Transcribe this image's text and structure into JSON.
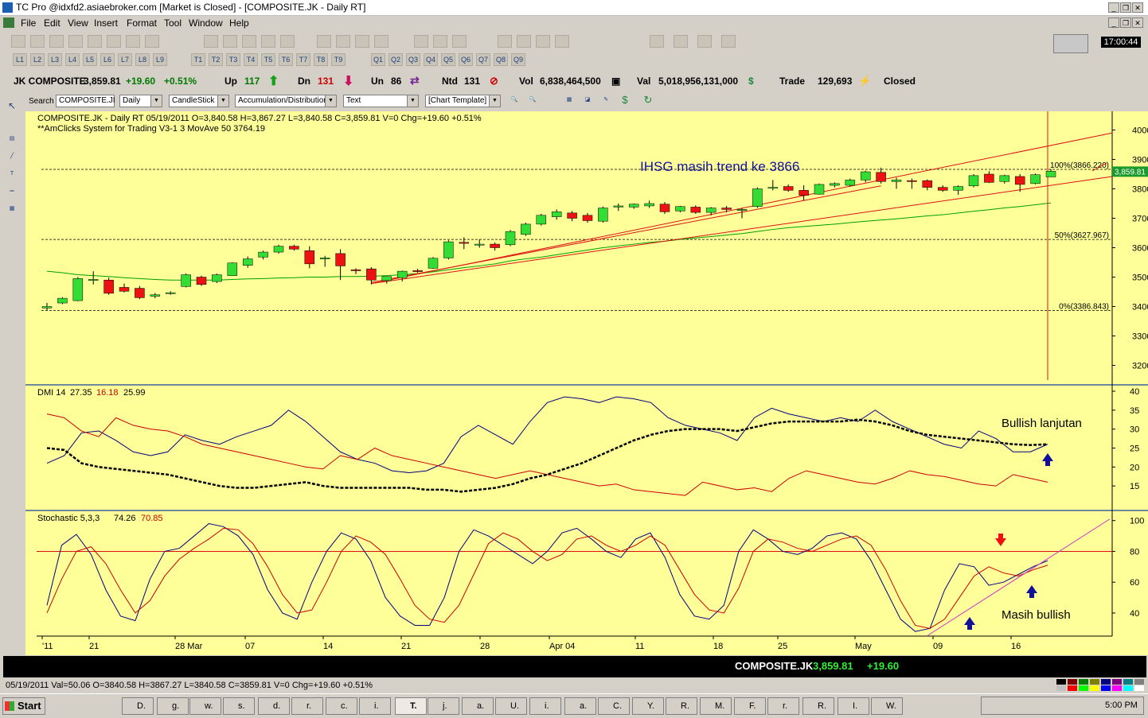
{
  "window": {
    "title": "TC Pro @idxfd2.asiaebroker.com [Market is Closed] - [COMPOSITE.JK - Daily RT]",
    "clock": "17:00:44"
  },
  "menu": [
    "File",
    "Edit",
    "View",
    "Insert",
    "Format",
    "Tool",
    "Window",
    "Help"
  ],
  "toolbar": {
    "layouts": [
      "L1",
      "L2",
      "L3",
      "L4",
      "L5",
      "L6",
      "L7",
      "L8",
      "L9"
    ],
    "templates": [
      "T1",
      "T2",
      "T3",
      "T4",
      "T5",
      "T6",
      "T7",
      "T8",
      "T9"
    ],
    "quotes": [
      "Q1",
      "Q2",
      "Q3",
      "Q4",
      "Q5",
      "Q6",
      "Q7",
      "Q8",
      "Q9"
    ]
  },
  "quote_bar": {
    "name": "JK COMPOSITE",
    "last": "3,859.81",
    "chg": "+19.60",
    "pct": "+0.51%",
    "up_label": "Up",
    "up": "117",
    "dn_label": "Dn",
    "dn": "131",
    "un_label": "Un",
    "un": "86",
    "ntd_label": "Ntd",
    "ntd": "131",
    "vol_label": "Vol",
    "vol": "6,838,464,500",
    "val_label": "Val",
    "val": "5,018,956,131,000",
    "trade_label": "Trade",
    "trade": "129,693",
    "status": "Closed"
  },
  "controls": {
    "search_label": "Search",
    "symbol": "COMPOSITE.JI",
    "period": "Daily",
    "style": "CandleStick",
    "indicator": "Accumulation/Distributior",
    "tool": "Text",
    "template": "[Chart Template]"
  },
  "chart_data": [
    {
      "type": "candlestick",
      "header": "COMPOSITE.JK - Daily RT  05/19/2011  O=3,840.58  H=3,867.27  L=3,840.58  C=3,859.81  V=0  Chg=+19.60  +0.51%",
      "subheader": "**AmClicks System for Trading V3-1 3   MovAve 50  3764.19",
      "annotation": "IHSG masih trend ke 3866",
      "ylim": [
        3150,
        4050
      ],
      "yticks": [
        3200,
        3300,
        3400,
        3500,
        3600,
        3700,
        3800,
        3900,
        4000
      ],
      "last_value_label": "3,859.81",
      "fib_levels": [
        {
          "label": "100%(3866.220)",
          "value": 3866.22
        },
        {
          "label": "50%(3627.967)",
          "value": 3627.967
        },
        {
          "label": "0%(3386.843)",
          "value": 3386.843
        }
      ],
      "candles": [
        {
          "o": 3395,
          "h": 3412,
          "l": 3388,
          "c": 3400
        },
        {
          "o": 3412,
          "h": 3432,
          "l": 3408,
          "c": 3428
        },
        {
          "o": 3420,
          "h": 3500,
          "l": 3418,
          "c": 3495
        },
        {
          "o": 3490,
          "h": 3520,
          "l": 3475,
          "c": 3492
        },
        {
          "o": 3490,
          "h": 3498,
          "l": 3440,
          "c": 3445
        },
        {
          "o": 3465,
          "h": 3478,
          "l": 3448,
          "c": 3452
        },
        {
          "o": 3462,
          "h": 3470,
          "l": 3425,
          "c": 3430
        },
        {
          "o": 3435,
          "h": 3446,
          "l": 3428,
          "c": 3440
        },
        {
          "o": 3445,
          "h": 3452,
          "l": 3440,
          "c": 3447
        },
        {
          "o": 3468,
          "h": 3512,
          "l": 3465,
          "c": 3508
        },
        {
          "o": 3500,
          "h": 3505,
          "l": 3470,
          "c": 3475
        },
        {
          "o": 3485,
          "h": 3512,
          "l": 3480,
          "c": 3508
        },
        {
          "o": 3505,
          "h": 3550,
          "l": 3505,
          "c": 3548
        },
        {
          "o": 3540,
          "h": 3570,
          "l": 3532,
          "c": 3562
        },
        {
          "o": 3568,
          "h": 3590,
          "l": 3560,
          "c": 3585
        },
        {
          "o": 3585,
          "h": 3610,
          "l": 3580,
          "c": 3605
        },
        {
          "o": 3605,
          "h": 3610,
          "l": 3590,
          "c": 3595
        },
        {
          "o": 3590,
          "h": 3605,
          "l": 3530,
          "c": 3545
        },
        {
          "o": 3565,
          "h": 3572,
          "l": 3535,
          "c": 3565
        },
        {
          "o": 3580,
          "h": 3595,
          "l": 3490,
          "c": 3538
        },
        {
          "o": 3525,
          "h": 3530,
          "l": 3510,
          "c": 3522
        },
        {
          "o": 3528,
          "h": 3534,
          "l": 3475,
          "c": 3490
        },
        {
          "o": 3488,
          "h": 3502,
          "l": 3478,
          "c": 3502
        },
        {
          "o": 3498,
          "h": 3522,
          "l": 3485,
          "c": 3520
        },
        {
          "o": 3522,
          "h": 3528,
          "l": 3515,
          "c": 3520
        },
        {
          "o": 3530,
          "h": 3568,
          "l": 3528,
          "c": 3564
        },
        {
          "o": 3565,
          "h": 3625,
          "l": 3560,
          "c": 3620
        },
        {
          "o": 3618,
          "h": 3635,
          "l": 3595,
          "c": 3615
        },
        {
          "o": 3612,
          "h": 3628,
          "l": 3600,
          "c": 3612
        },
        {
          "o": 3612,
          "h": 3618,
          "l": 3590,
          "c": 3600
        },
        {
          "o": 3610,
          "h": 3660,
          "l": 3605,
          "c": 3655
        },
        {
          "o": 3645,
          "h": 3685,
          "l": 3640,
          "c": 3680
        },
        {
          "o": 3680,
          "h": 3715,
          "l": 3675,
          "c": 3710
        },
        {
          "o": 3705,
          "h": 3730,
          "l": 3695,
          "c": 3722
        },
        {
          "o": 3718,
          "h": 3725,
          "l": 3690,
          "c": 3700
        },
        {
          "o": 3710,
          "h": 3718,
          "l": 3685,
          "c": 3692
        },
        {
          "o": 3690,
          "h": 3740,
          "l": 3685,
          "c": 3735
        },
        {
          "o": 3738,
          "h": 3750,
          "l": 3725,
          "c": 3742
        },
        {
          "o": 3738,
          "h": 3750,
          "l": 3732,
          "c": 3748
        },
        {
          "o": 3742,
          "h": 3760,
          "l": 3735,
          "c": 3750
        },
        {
          "o": 3748,
          "h": 3755,
          "l": 3715,
          "c": 3722
        },
        {
          "o": 3725,
          "h": 3742,
          "l": 3720,
          "c": 3740
        },
        {
          "o": 3738,
          "h": 3744,
          "l": 3715,
          "c": 3720
        },
        {
          "o": 3720,
          "h": 3738,
          "l": 3710,
          "c": 3735
        },
        {
          "o": 3735,
          "h": 3742,
          "l": 3720,
          "c": 3730
        },
        {
          "o": 3728,
          "h": 3735,
          "l": 3700,
          "c": 3730
        },
        {
          "o": 3740,
          "h": 3805,
          "l": 3735,
          "c": 3800
        },
        {
          "o": 3802,
          "h": 3830,
          "l": 3795,
          "c": 3805
        },
        {
          "o": 3808,
          "h": 3815,
          "l": 3790,
          "c": 3795
        },
        {
          "o": 3795,
          "h": 3812,
          "l": 3760,
          "c": 3778
        },
        {
          "o": 3782,
          "h": 3818,
          "l": 3780,
          "c": 3815
        },
        {
          "o": 3812,
          "h": 3822,
          "l": 3805,
          "c": 3818
        },
        {
          "o": 3812,
          "h": 3835,
          "l": 3808,
          "c": 3830
        },
        {
          "o": 3830,
          "h": 3862,
          "l": 3822,
          "c": 3858
        },
        {
          "o": 3856,
          "h": 3872,
          "l": 3818,
          "c": 3825
        },
        {
          "o": 3825,
          "h": 3838,
          "l": 3800,
          "c": 3830
        },
        {
          "o": 3828,
          "h": 3835,
          "l": 3800,
          "c": 3825
        },
        {
          "o": 3828,
          "h": 3832,
          "l": 3795,
          "c": 3805
        },
        {
          "o": 3805,
          "h": 3812,
          "l": 3790,
          "c": 3795
        },
        {
          "o": 3795,
          "h": 3812,
          "l": 3780,
          "c": 3808
        },
        {
          "o": 3810,
          "h": 3850,
          "l": 3805,
          "c": 3845
        },
        {
          "o": 3850,
          "h": 3860,
          "l": 3820,
          "c": 3822
        },
        {
          "o": 3825,
          "h": 3848,
          "l": 3818,
          "c": 3845
        },
        {
          "o": 3842,
          "h": 3850,
          "l": 3790,
          "c": 3815
        },
        {
          "o": 3818,
          "h": 3852,
          "l": 3815,
          "c": 3848
        },
        {
          "o": 3840.58,
          "h": 3867.27,
          "l": 3840.58,
          "c": 3859.81
        }
      ],
      "ma50": [
        3520,
        3515,
        3508,
        3505,
        3502,
        3498,
        3495,
        3492,
        3490,
        3490,
        3490,
        3490,
        3492,
        3494,
        3495,
        3497,
        3498,
        3500,
        3500,
        3502,
        3502,
        3503,
        3505,
        3508,
        3512,
        3518,
        3525,
        3532,
        3538,
        3545,
        3555,
        3562,
        3568,
        3576,
        3584,
        3592,
        3600,
        3606,
        3612,
        3618,
        3622,
        3628,
        3633,
        3638,
        3643,
        3648,
        3655,
        3662,
        3668,
        3672,
        3676,
        3680,
        3685,
        3690,
        3694,
        3698,
        3703,
        3708,
        3712,
        3718,
        3724,
        3729,
        3735,
        3740,
        3746,
        3752
      ]
    },
    {
      "type": "line",
      "title": "DMI 14",
      "values_text": [
        "27.35",
        "16.18",
        "25.99"
      ],
      "annotation": "Bullish lanjutan",
      "ylim": [
        10,
        40
      ],
      "yticks": [
        15,
        20,
        25,
        30,
        35,
        40
      ],
      "series": [
        {
          "color": "#000080",
          "values": [
            21,
            23,
            29,
            29.5,
            27,
            24,
            23,
            24,
            28.5,
            27,
            26,
            28,
            29.5,
            31,
            35,
            32,
            28,
            24,
            22,
            21,
            19,
            18.5,
            19,
            21,
            28,
            31,
            28.5,
            26,
            32,
            37,
            38.5,
            38,
            37,
            38.5,
            38,
            37,
            33,
            31,
            30,
            29,
            27,
            33,
            35.5,
            34,
            33,
            32,
            33,
            32,
            35,
            32,
            30,
            28,
            26,
            25,
            29.5,
            27.5,
            24,
            24,
            26
          ]
        },
        {
          "color": "#cc0000",
          "values": [
            34,
            33,
            29.5,
            28,
            33,
            31,
            30,
            29.5,
            28,
            26,
            25,
            24,
            23,
            22,
            21,
            20,
            19.5,
            23,
            22,
            25,
            23,
            22,
            21,
            20,
            19,
            18,
            17,
            18,
            19,
            18,
            17,
            16,
            15,
            15.5,
            14,
            13.5,
            13,
            12.5,
            16,
            15,
            14,
            14.5,
            13.5,
            17,
            19,
            18,
            17,
            16,
            15.5,
            17,
            19,
            18,
            17.5,
            16.5,
            15.5,
            15,
            18,
            17,
            16
          ]
        },
        {
          "color": "#000000",
          "dashed": true,
          "values": [
            25,
            24.5,
            21,
            20,
            19.5,
            19,
            18.5,
            18,
            17,
            16,
            15,
            14.5,
            14.5,
            15,
            15.5,
            16,
            15,
            14.5,
            14.5,
            14.5,
            14.5,
            14.5,
            14,
            14,
            13.5,
            14,
            14.5,
            15.5,
            17,
            18,
            19.5,
            21,
            23,
            25,
            27,
            28.5,
            29.5,
            30,
            30,
            30,
            29.5,
            30.5,
            31.5,
            32,
            32,
            32,
            32,
            32.5,
            32,
            31,
            29.5,
            28.5,
            28,
            27.5,
            27,
            26.5,
            26,
            25.8,
            26
          ]
        }
      ]
    },
    {
      "type": "line",
      "title": "Stochastic 5,3,3",
      "values_text": [
        "74.26",
        "70.85"
      ],
      "annotation": "Masih bullish",
      "ylim": [
        25,
        105
      ],
      "yticks": [
        40,
        60,
        80,
        100
      ],
      "series": [
        {
          "color": "#000080",
          "values": [
            45,
            84,
            91,
            78,
            55,
            38,
            35,
            62,
            80,
            82,
            90,
            98,
            96,
            90,
            78,
            55,
            40,
            36,
            60,
            80,
            92,
            88,
            74,
            50,
            38,
            32,
            32,
            50,
            80,
            94,
            90,
            84,
            78,
            72,
            80,
            92,
            95,
            88,
            80,
            76,
            88,
            92,
            76,
            52,
            38,
            36,
            45,
            80,
            94,
            88,
            80,
            78,
            82,
            90,
            92,
            88,
            74,
            55,
            36,
            28,
            30,
            55,
            72,
            70,
            58,
            60,
            65,
            70,
            74
          ]
        },
        {
          "color": "#cc0000",
          "values": [
            40,
            62,
            80,
            83,
            72,
            55,
            40,
            48,
            64,
            75,
            82,
            88,
            95,
            94,
            85,
            70,
            52,
            40,
            42,
            60,
            80,
            90,
            86,
            78,
            62,
            45,
            36,
            34,
            45,
            65,
            85,
            92,
            88,
            80,
            74,
            78,
            88,
            90,
            84,
            80,
            84,
            90,
            84,
            68,
            52,
            42,
            40,
            56,
            80,
            88,
            86,
            82,
            80,
            84,
            88,
            90,
            84,
            68,
            48,
            32,
            30,
            36,
            50,
            64,
            70,
            66,
            64,
            68,
            71
          ]
        }
      ]
    }
  ],
  "x_axis_labels": [
    "'11",
    "21",
    "28 Mar",
    "07",
    "14",
    "21",
    "28",
    "Apr 04",
    "11",
    "18",
    "25",
    "May",
    "09",
    "16"
  ],
  "footer": {
    "symbol": "COMPOSITE.JK",
    "price": "3,859.81",
    "chg": "+19.60"
  },
  "status_bar": "05/19/2011  Val=50.06  O=3840.58  H=3867.27  L=3840.58  C=3859.81  V=0  Chg=+19.60  +0.51%",
  "taskbar": {
    "start": "Start",
    "time": "5:00 PM",
    "items": [
      "D.",
      "g.",
      "w.",
      "s.",
      "d.",
      "r.",
      "c.",
      "i.",
      "T.",
      "j.",
      "a.",
      "U.",
      "i.",
      "a.",
      "C.",
      "Y.",
      "R.",
      "M.",
      "F.",
      "r.",
      "R.",
      "I.",
      "W."
    ]
  },
  "colors": {
    "chart_bg": "#ffff99",
    "up": "#33dd33",
    "down": "#ee1111"
  }
}
